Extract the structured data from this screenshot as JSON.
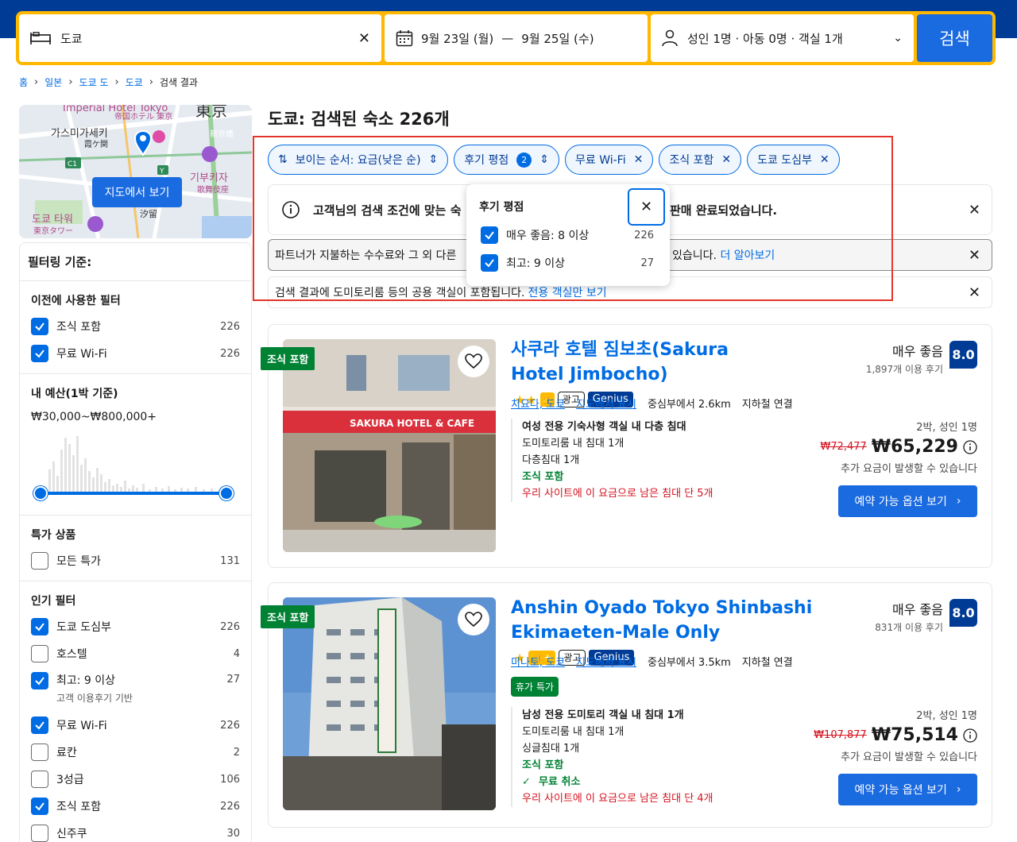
{
  "search": {
    "destination": "도쿄",
    "dates_start": "9월 23일 (월)",
    "dates_sep": "—",
    "dates_end": "9월 25일 (수)",
    "guests": "성인 1명 · 아동 0명 · 객실 1개",
    "button": "검색"
  },
  "breadcrumb": [
    "홈",
    "일본",
    "도쿄 도",
    "도쿄",
    "검색 결과"
  ],
  "map": {
    "button": "지도에서 보기",
    "labels": [
      "Imperial Hotel Tokyo",
      "帝国ホテル 東京",
      "東京",
      "가스미가세키",
      "霞ケ関",
      "新京橋",
      "기부키자",
      "歌舞伎座",
      "도쿄 타워",
      "東京タワー",
      "汐留",
      "C1",
      "Y"
    ]
  },
  "filters": {
    "title": "필터링 기준:",
    "previous": {
      "heading": "이전에 사용한 필터",
      "items": [
        {
          "label": "조식 포함",
          "count": "226",
          "checked": true
        },
        {
          "label": "무료 Wi-Fi",
          "count": "226",
          "checked": true
        }
      ]
    },
    "budget": {
      "heading": "내 예산(1박 기준)",
      "value": "₩30,000~₩800,000+"
    },
    "deals": {
      "heading": "특가 상품",
      "items": [
        {
          "label": "모든 특가",
          "count": "131",
          "checked": false
        }
      ]
    },
    "popular": {
      "heading": "인기 필터",
      "items": [
        {
          "label": "도쿄 도심부",
          "count": "226",
          "checked": true
        },
        {
          "label": "호스텔",
          "count": "4",
          "checked": false
        },
        {
          "label": "최고: 9 이상",
          "count": "27",
          "checked": true,
          "sub": "고객 이용후기 기반"
        },
        {
          "label": "무료 Wi-Fi",
          "count": "226",
          "checked": true
        },
        {
          "label": "료칸",
          "count": "2",
          "checked": false
        },
        {
          "label": "3성급",
          "count": "106",
          "checked": false
        },
        {
          "label": "조식 포함",
          "count": "226",
          "checked": true
        },
        {
          "label": "신주쿠",
          "count": "30",
          "checked": false
        }
      ]
    }
  },
  "results": {
    "title": "도쿄: 검색된 숙소 226개",
    "chips": {
      "sort": "보이는 순서: 요금(낮은 순)",
      "review": "후기 평점",
      "review_count": "2",
      "wifi": "무료 Wi-Fi",
      "breakfast": "조식 포함",
      "downtown": "도쿄 도심부"
    },
    "notice1_a": "고객님의 검색 조건에 맞는 숙",
    "notice1_b": "판매 완료되었습니다.",
    "notice2_a": "파트너가 지불하는 수수료와 그 외 다른",
    "notice2_b": "있습니다.",
    "notice2_link": "더 알아보기",
    "notice3_text": "검색 결과에 도미토리룸 등의 공용 객실이 포함됩니다.",
    "notice3_link": "전용 객실만 보기"
  },
  "review_dropdown": {
    "title": "후기 평점",
    "options": [
      {
        "label": "매우 좋음: 8 이상",
        "count": "226",
        "checked": true
      },
      {
        "label": "최고: 9 이상",
        "count": "27",
        "checked": true
      }
    ]
  },
  "hotels": [
    {
      "ribbon": "조식 포함",
      "name": "사쿠라 호텔 짐보초(Sakura Hotel Jimbocho)",
      "stars": "★★",
      "ad": "광고",
      "genius": "Genius",
      "area": "치요다, 도쿄",
      "map_link": "지도에서 표시",
      "distance": "중심부에서 2.6km",
      "metro": "지하철 연결",
      "rating_label": "매우 좋음",
      "review_count": "1,897개 이용 후기",
      "score": "8.0",
      "room_title": "여성 전용 기숙사형 객실 내 다층 침대",
      "room_line1": "도미토리룸 내 침대 1개",
      "room_line2": "다층침대 1개",
      "breakfast": "조식 포함",
      "scarcity": "우리 사이트에 이 요금으로 남은 침대 단 5개",
      "occupancy": "2박, 성인 1명",
      "old_price": "₩72,477",
      "price": "₩65,229",
      "extra": "추가 요금이 발생할 수 있습니다",
      "cta": "예약 가능 옵션 보기",
      "sign": "SAKURA HOTEL & CAFE"
    },
    {
      "ribbon": "조식 포함",
      "name": "Anshin Oyado Tokyo Shinbashi Ekimaeten-Male Only",
      "stars": "★",
      "ad": "광고",
      "genius": "Genius",
      "area": "미나토, 도쿄",
      "map_link": "지도에서 표시",
      "distance": "중심부에서 3.5km",
      "metro": "지하철 연결",
      "deal_badge": "휴가 특가",
      "rating_label": "매우 좋음",
      "review_count": "831개 이용 후기",
      "score": "8.0",
      "room_title": "남성 전용 도미토리 객실 내 침대 1개",
      "room_line1": "도미토리룸 내 침대 1개",
      "room_line2": "싱글침대 1개",
      "breakfast": "조식 포함",
      "cancel": "무료 취소",
      "scarcity": "우리 사이트에 이 요금으로 남은 침대 단 4개",
      "occupancy": "2박, 성인 1명",
      "old_price": "₩107,877",
      "price": "₩75,514",
      "extra": "추가 요금이 발생할 수 있습니다",
      "cta": "예약 가능 옵션 보기"
    }
  ],
  "colors": {
    "brand": "#003b95",
    "accent": "#006ce4",
    "button": "#1a6ae0",
    "highlight": "#e5352b",
    "search_border": "#ffb700",
    "green": "#008234"
  }
}
